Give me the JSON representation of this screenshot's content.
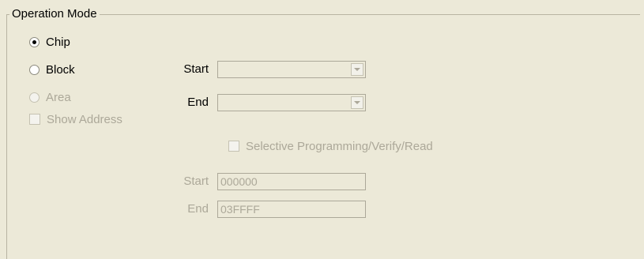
{
  "group": {
    "label": "Operation Mode"
  },
  "modes": {
    "chip": "Chip",
    "block": "Block",
    "area": "Area",
    "show_address": "Show Address"
  },
  "block_range": {
    "start_label": "Start",
    "end_label": "End",
    "start_value": "",
    "end_value": ""
  },
  "selective": {
    "label": "Selective Programming/Verify/Read"
  },
  "address_range": {
    "start_label": "Start",
    "start_value": "000000",
    "end_label": "End",
    "end_value": "03FFFF"
  }
}
